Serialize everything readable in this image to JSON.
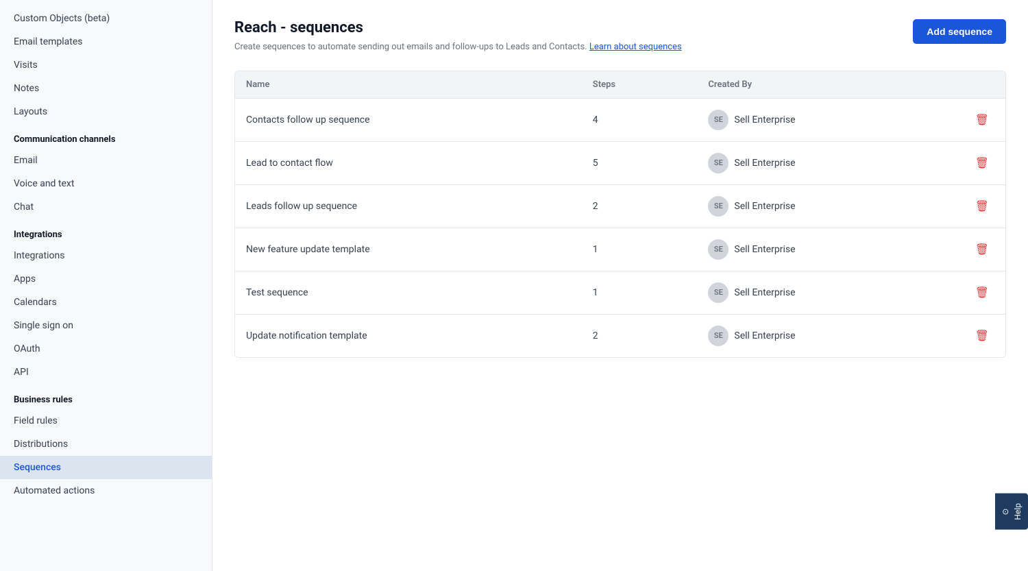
{
  "sidebar": {
    "items_top": [
      {
        "id": "custom-objects",
        "label": "Custom Objects (beta)",
        "active": false
      },
      {
        "id": "email-templates",
        "label": "Email templates",
        "active": false
      },
      {
        "id": "visits",
        "label": "Visits",
        "active": false
      },
      {
        "id": "notes",
        "label": "Notes",
        "active": false
      },
      {
        "id": "layouts",
        "label": "Layouts",
        "active": false
      }
    ],
    "sections": [
      {
        "id": "communication-channels",
        "header": "Communication channels",
        "items": [
          {
            "id": "email",
            "label": "Email",
            "active": false
          },
          {
            "id": "voice-and-text",
            "label": "Voice and text",
            "active": false
          },
          {
            "id": "chat",
            "label": "Chat",
            "active": false
          }
        ]
      },
      {
        "id": "integrations",
        "header": "Integrations",
        "items": [
          {
            "id": "integrations",
            "label": "Integrations",
            "active": false
          },
          {
            "id": "apps",
            "label": "Apps",
            "active": false
          },
          {
            "id": "calendars",
            "label": "Calendars",
            "active": false
          },
          {
            "id": "single-sign-on",
            "label": "Single sign on",
            "active": false
          },
          {
            "id": "oauth",
            "label": "OAuth",
            "active": false
          },
          {
            "id": "api",
            "label": "API",
            "active": false
          }
        ]
      },
      {
        "id": "business-rules",
        "header": "Business rules",
        "items": [
          {
            "id": "field-rules",
            "label": "Field rules",
            "active": false
          },
          {
            "id": "distributions",
            "label": "Distributions",
            "active": false
          },
          {
            "id": "sequences",
            "label": "Sequences",
            "active": true
          },
          {
            "id": "automated-actions",
            "label": "Automated actions",
            "active": false
          }
        ]
      }
    ]
  },
  "page": {
    "title": "Reach - sequences",
    "subtitle": "Create sequences to automate sending out emails and follow-ups to Leads and Contacts.",
    "learn_link_text": "Learn about sequences",
    "add_button_label": "Add sequence"
  },
  "table": {
    "columns": [
      {
        "id": "name",
        "label": "Name"
      },
      {
        "id": "steps",
        "label": "Steps"
      },
      {
        "id": "created_by",
        "label": "Created By"
      },
      {
        "id": "action",
        "label": ""
      }
    ],
    "rows": [
      {
        "id": 1,
        "name": "Contacts follow up sequence",
        "steps": "4",
        "avatar": "SE",
        "created_by": "Sell Enterprise"
      },
      {
        "id": 2,
        "name": "Lead to contact flow",
        "steps": "5",
        "avatar": "SE",
        "created_by": "Sell Enterprise"
      },
      {
        "id": 3,
        "name": "Leads follow up sequence",
        "steps": "2",
        "avatar": "SE",
        "created_by": "Sell Enterprise"
      },
      {
        "id": 4,
        "name": "New feature update template",
        "steps": "1",
        "avatar": "SE",
        "created_by": "Sell Enterprise"
      },
      {
        "id": 5,
        "name": "Test sequence",
        "steps": "1",
        "avatar": "SE",
        "created_by": "Sell Enterprise"
      },
      {
        "id": 6,
        "name": "Update notification template",
        "steps": "2",
        "avatar": "SE",
        "created_by": "Sell Enterprise"
      }
    ]
  },
  "help": {
    "label": "Help"
  }
}
